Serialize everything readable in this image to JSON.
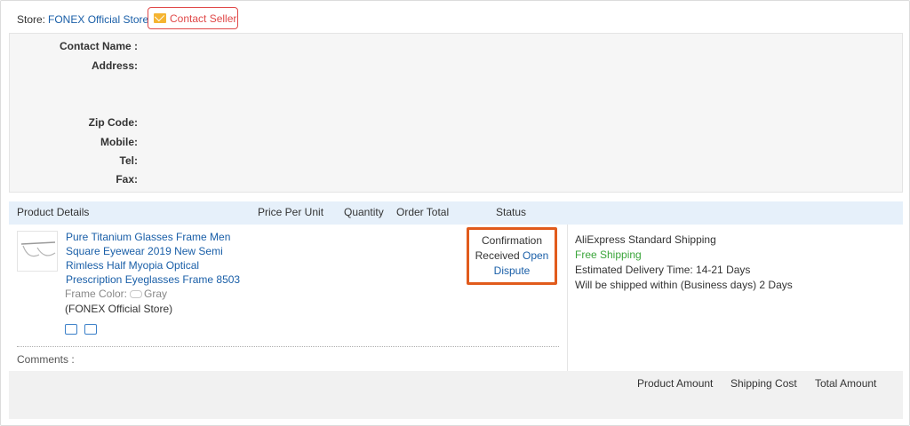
{
  "store": {
    "prefix": "Store:",
    "name": "FONEX Official Store",
    "contact_label": "Contact Seller",
    "contact_icon": "mail-icon"
  },
  "address": {
    "contact_name_label": "Contact Name :",
    "address_label": "Address:",
    "zip_label": "Zip Code:",
    "mobile_label": "Mobile:",
    "tel_label": "Tel:",
    "fax_label": "Fax:"
  },
  "table": {
    "headers": {
      "product_details": "Product Details",
      "price_per_unit": "Price Per Unit",
      "quantity": "Quantity",
      "order_total": "Order Total",
      "status": "Status"
    }
  },
  "product": {
    "title_lines": [
      "Pure Titanium Glasses Frame Men",
      "Square Eyewear 2019 New Semi",
      "Rimless Half Myopia Optical",
      "Prescription Eyeglasses Frame 8503"
    ],
    "attr_label": "Frame Color:",
    "attr_value": "Gray",
    "store_name": "(FONEX Official Store)"
  },
  "status": {
    "line1": "Confirmation",
    "line2_plain": "Received",
    "line2_link": "Open",
    "line3_link": "Dispute"
  },
  "shipping": {
    "method": "AliExpress Standard Shipping",
    "free": "Free Shipping",
    "delivery": "Estimated Delivery Time:  14-21 Days",
    "ship_within": "Will be shipped within (Business days)  2 Days"
  },
  "comments_label": "Comments :",
  "footer": {
    "product_amount": "Product Amount",
    "shipping_cost": "Shipping Cost",
    "total_amount": "Total Amount"
  },
  "colors": {
    "link": "#1a5fa8",
    "accent_red": "#e04848",
    "highlight": "#e15b1c",
    "free_shipping": "#3aa53a"
  }
}
